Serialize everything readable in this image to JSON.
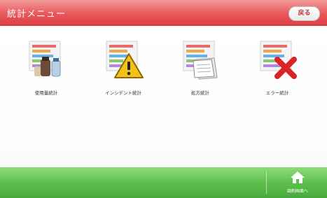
{
  "header": {
    "title": "統計メニュー",
    "back_label": "戻る"
  },
  "menu": [
    {
      "label": "使用量統計",
      "icon": "chart-bottles-icon"
    },
    {
      "label": "インシデント統計",
      "icon": "chart-warning-icon"
    },
    {
      "label": "処方統計",
      "icon": "chart-documents-icon"
    },
    {
      "label": "エラー統計",
      "icon": "chart-error-icon"
    }
  ],
  "footer": {
    "home_label": "調剤画面へ",
    "home_icon": "home-icon"
  },
  "colors": {
    "header": "#e8585b",
    "footer": "#5fc04d",
    "accent_red": "#c0383c"
  }
}
